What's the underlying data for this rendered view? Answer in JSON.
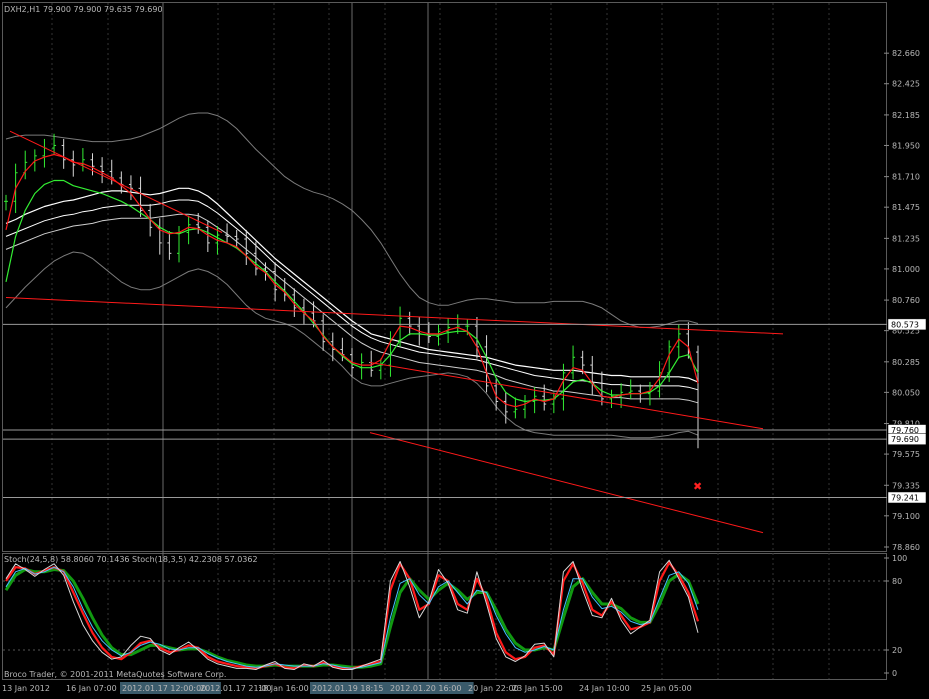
{
  "chart_data": {
    "type": "line",
    "header": {
      "symbol": "DXH2,H1",
      "ohlc": "79.900 79.900 79.635 79.690"
    },
    "price_axis": {
      "ylim": [
        78.86,
        82.9
      ],
      "ticks": [
        "82.660",
        "82.425",
        "82.185",
        "81.950",
        "81.710",
        "81.475",
        "81.235",
        "81.000",
        "80.760",
        "80.525",
        "80.285",
        "80.050",
        "79.810",
        "79.575",
        "79.335",
        "79.100",
        "78.860"
      ]
    },
    "levels": [
      {
        "label": "80.573",
        "value": 80.573
      },
      {
        "label": "79.760",
        "value": 79.76
      },
      {
        "label": "79.690",
        "value": 79.69
      },
      {
        "label": "79.241",
        "value": 79.241
      }
    ],
    "time_axis": {
      "labels": [
        "13 Jan 2012",
        "16 Jan 07:00",
        "2012.01.17 12:00:00",
        "2012.01.17 21:00",
        "18 Jan 16:00",
        "2012.01.19 18:15",
        "2012.01.20 16:00",
        "20 Jan 22:00",
        "23 Jan 15:00",
        "24 Jan 10:00",
        "25 Jan 05:00"
      ],
      "highlighted": [
        "2012.01.17 12:00:00",
        "2012.01.19 18:15",
        "2012.01.20 16:00"
      ]
    },
    "series": [
      {
        "name": "Close",
        "y": [
          81.52,
          81.74,
          81.82,
          81.87,
          81.93,
          81.95,
          81.84,
          81.8,
          81.84,
          81.79,
          81.75,
          81.7,
          81.65,
          81.62,
          81.45,
          81.32,
          81.2,
          81.12,
          81.28,
          81.34,
          81.32,
          81.2,
          81.26,
          81.25,
          81.23,
          81.12,
          81.0,
          80.98,
          80.84,
          80.8,
          80.7,
          80.66,
          80.6,
          80.44,
          80.38,
          80.34,
          80.24,
          80.28,
          80.22,
          80.26,
          80.45,
          80.62,
          80.56,
          80.5,
          80.48,
          80.52,
          80.55,
          80.56,
          80.56,
          80.4,
          80.1,
          79.98,
          79.9,
          79.92,
          79.98,
          80.02,
          79.96,
          80.0,
          80.2,
          80.32,
          80.26,
          80.12,
          80.0,
          80.02,
          80.05,
          80.06,
          80.04,
          80.06,
          80.2,
          80.4,
          80.5,
          80.36,
          79.69
        ]
      },
      {
        "name": "MA fast",
        "y": [
          81.3,
          81.62,
          81.75,
          81.83,
          81.86,
          81.88,
          81.86,
          81.82,
          81.81,
          81.78,
          81.74,
          81.7,
          81.64,
          81.58,
          81.48,
          81.38,
          81.3,
          81.27,
          81.28,
          81.32,
          81.31,
          81.26,
          81.22,
          81.2,
          81.17,
          81.1,
          81.02,
          80.97,
          80.88,
          80.82,
          80.73,
          80.66,
          80.6,
          80.48,
          80.4,
          80.34,
          80.28,
          80.26,
          80.26,
          80.3,
          80.44,
          80.56,
          80.55,
          80.52,
          80.5,
          80.5,
          80.53,
          80.55,
          80.52,
          80.4,
          80.2,
          80.02,
          79.96,
          79.94,
          79.96,
          80.0,
          79.98,
          80.0,
          80.14,
          80.24,
          80.22,
          80.12,
          80.02,
          80.01,
          80.03,
          80.04,
          80.04,
          80.06,
          80.16,
          80.34,
          80.46,
          80.4,
          80.12
        ]
      },
      {
        "name": "MA slow",
        "y": [
          80.9,
          81.25,
          81.45,
          81.58,
          81.65,
          81.68,
          81.68,
          81.64,
          81.62,
          81.6,
          81.58,
          81.55,
          81.52,
          81.48,
          81.43,
          81.38,
          81.32,
          81.28,
          81.27,
          81.3,
          81.31,
          81.28,
          81.24,
          81.2,
          81.16,
          81.1,
          81.04,
          80.98,
          80.9,
          80.83,
          80.75,
          80.67,
          80.58,
          80.49,
          80.4,
          80.33,
          80.27,
          80.24,
          80.24,
          80.26,
          80.34,
          80.45,
          80.5,
          80.5,
          80.49,
          80.49,
          80.51,
          80.52,
          80.52,
          80.46,
          80.32,
          80.16,
          80.05,
          80.0,
          79.98,
          79.99,
          79.99,
          80.0,
          80.06,
          80.13,
          80.15,
          80.12,
          80.06,
          80.03,
          80.03,
          80.04,
          80.04,
          80.05,
          80.1,
          80.2,
          80.32,
          80.34,
          80.2
        ]
      },
      {
        "name": "EMA 1",
        "y": [
          81.35,
          81.38,
          81.42,
          81.45,
          81.48,
          81.5,
          81.52,
          81.53,
          81.55,
          81.57,
          81.59,
          81.6,
          81.6,
          81.59,
          81.58,
          81.57,
          81.58,
          81.6,
          81.62,
          81.62,
          81.6,
          81.56,
          81.5,
          81.43,
          81.36,
          81.29,
          81.22,
          81.15,
          81.08,
          81.02,
          80.96,
          80.9,
          80.84,
          80.78,
          80.72,
          80.66,
          80.6,
          80.55,
          80.5,
          80.48,
          80.46,
          80.44,
          80.42,
          80.4,
          80.38,
          80.37,
          80.36,
          80.35,
          80.34,
          80.33,
          80.32,
          80.3,
          80.28,
          80.26,
          80.25,
          80.24,
          80.23,
          80.22,
          80.22,
          80.22,
          80.21,
          80.2,
          80.19,
          80.18,
          80.18,
          80.17,
          80.17,
          80.17,
          80.17,
          80.17,
          80.17,
          80.16,
          80.13
        ]
      },
      {
        "name": "EMA 2",
        "y": [
          81.25,
          81.28,
          81.31,
          81.34,
          81.37,
          81.39,
          81.41,
          81.42,
          81.44,
          81.45,
          81.47,
          81.48,
          81.49,
          81.49,
          81.49,
          81.49,
          81.5,
          81.52,
          81.53,
          81.53,
          81.52,
          81.48,
          81.43,
          81.37,
          81.31,
          81.25,
          81.18,
          81.11,
          81.04,
          80.98,
          80.92,
          80.86,
          80.8,
          80.74,
          80.68,
          80.62,
          80.56,
          80.51,
          80.47,
          80.44,
          80.42,
          80.4,
          80.38,
          80.36,
          80.35,
          80.34,
          80.33,
          80.32,
          80.31,
          80.3,
          80.28,
          80.26,
          80.24,
          80.22,
          80.2,
          80.18,
          80.17,
          80.16,
          80.15,
          80.14,
          80.14,
          80.13,
          80.12,
          80.11,
          80.11,
          80.1,
          80.1,
          80.1,
          80.1,
          80.1,
          80.1,
          80.09,
          80.07
        ]
      },
      {
        "name": "EMA 3",
        "y": [
          81.15,
          81.18,
          81.21,
          81.24,
          81.27,
          81.29,
          81.31,
          81.33,
          81.34,
          81.35,
          81.37,
          81.38,
          81.39,
          81.39,
          81.39,
          81.39,
          81.4,
          81.41,
          81.42,
          81.42,
          81.41,
          81.37,
          81.32,
          81.27,
          81.21,
          81.15,
          81.09,
          81.02,
          80.96,
          80.9,
          80.84,
          80.78,
          80.72,
          80.66,
          80.6,
          80.54,
          80.48,
          80.43,
          80.39,
          80.36,
          80.34,
          80.32,
          80.3,
          80.28,
          80.27,
          80.26,
          80.25,
          80.24,
          80.23,
          80.22,
          80.2,
          80.18,
          80.15,
          80.13,
          80.11,
          80.09,
          80.08,
          80.06,
          80.06,
          80.05,
          80.04,
          80.03,
          80.02,
          80.01,
          80.01,
          80.0,
          80.0,
          80.0,
          80.0,
          80.0,
          80.0,
          79.99,
          79.97
        ]
      },
      {
        "name": "Upper band",
        "y": [
          82.0,
          82.02,
          82.03,
          82.03,
          82.03,
          82.02,
          82.01,
          82.0,
          81.99,
          81.98,
          81.98,
          81.98,
          81.99,
          82.0,
          82.02,
          82.05,
          82.08,
          82.12,
          82.16,
          82.19,
          82.2,
          82.2,
          82.18,
          82.14,
          82.08,
          82.0,
          81.92,
          81.85,
          81.78,
          81.71,
          81.66,
          81.62,
          81.59,
          81.57,
          81.54,
          81.5,
          81.45,
          81.38,
          81.3,
          81.2,
          81.08,
          80.96,
          80.86,
          80.78,
          80.74,
          80.72,
          80.72,
          80.74,
          80.76,
          80.77,
          80.77,
          80.76,
          80.75,
          80.74,
          80.74,
          80.74,
          80.74,
          80.75,
          80.75,
          80.75,
          80.75,
          80.73,
          80.7,
          80.65,
          80.6,
          80.57,
          80.55,
          80.55,
          80.56,
          80.58,
          80.6,
          80.6,
          80.58
        ]
      },
      {
        "name": "Lower band",
        "y": [
          80.7,
          80.78,
          80.86,
          80.93,
          81.0,
          81.06,
          81.1,
          81.13,
          81.12,
          81.08,
          81.02,
          80.96,
          80.9,
          80.86,
          80.84,
          80.84,
          80.86,
          80.9,
          80.94,
          80.98,
          81.0,
          80.98,
          80.94,
          80.88,
          80.8,
          80.72,
          80.66,
          80.62,
          80.6,
          80.58,
          80.55,
          80.5,
          80.44,
          80.38,
          80.32,
          80.25,
          80.17,
          80.12,
          80.1,
          80.1,
          80.12,
          80.14,
          80.16,
          80.17,
          80.18,
          80.19,
          80.2,
          80.19,
          80.17,
          80.12,
          80.04,
          79.94,
          79.86,
          79.8,
          79.76,
          79.74,
          79.73,
          79.72,
          79.72,
          79.72,
          79.72,
          79.72,
          79.72,
          79.72,
          79.71,
          79.7,
          79.7,
          79.7,
          79.71,
          79.72,
          79.74,
          79.75,
          79.72
        ]
      },
      {
        "name": "Trendline A",
        "y": [
          82.06,
          81.28
        ]
      },
      {
        "name": "Trendline B",
        "y": [
          80.78,
          80.5
        ]
      },
      {
        "name": "Channel line 1",
        "y": [
          80.28,
          79.77
        ]
      },
      {
        "name": "Channel line 2",
        "y": [
          79.74,
          78.97
        ]
      }
    ],
    "oscillator": {
      "label": "Stoch(24,5,8) 58.8060 70.1436  Stoch(18,3,5) 42.2308 57.0362",
      "ylim": [
        0,
        100
      ],
      "ticks": [
        "100",
        "80",
        "20",
        "0"
      ],
      "series": [
        {
          "name": "Stoch(24,5,8) %K",
          "y": [
            80,
            92,
            91,
            86,
            89,
            92,
            88,
            70,
            52,
            35,
            22,
            14,
            12,
            18,
            26,
            28,
            22,
            18,
            20,
            24,
            22,
            14,
            10,
            8,
            6,
            5,
            4,
            6,
            8,
            5,
            4,
            7,
            6,
            9,
            6,
            4,
            4,
            6,
            8,
            10,
            72,
            95,
            82,
            55,
            60,
            85,
            80,
            60,
            55,
            82,
            65,
            35,
            18,
            12,
            14,
            22,
            24,
            16,
            80,
            95,
            78,
            55,
            50,
            62,
            50,
            38,
            40,
            44,
            80,
            96,
            85,
            70,
            45
          ]
        },
        {
          "name": "Stoch(24,5,8) %D",
          "y": [
            72,
            85,
            90,
            88,
            88,
            90,
            89,
            80,
            65,
            48,
            33,
            22,
            16,
            16,
            20,
            24,
            24,
            22,
            20,
            21,
            21,
            18,
            14,
            11,
            9,
            7,
            6,
            6,
            7,
            6,
            6,
            6,
            6,
            7,
            7,
            6,
            5,
            5,
            6,
            8,
            40,
            70,
            82,
            72,
            64,
            72,
            78,
            72,
            64,
            70,
            70,
            55,
            38,
            26,
            20,
            20,
            22,
            20,
            48,
            75,
            82,
            70,
            60,
            60,
            56,
            48,
            44,
            44,
            60,
            80,
            86,
            80,
            60
          ]
        },
        {
          "name": "Stoch(18,3,5) %K",
          "y": [
            82,
            95,
            90,
            84,
            90,
            95,
            85,
            62,
            42,
            28,
            18,
            12,
            14,
            24,
            32,
            30,
            20,
            16,
            22,
            27,
            20,
            12,
            8,
            6,
            4,
            4,
            3,
            7,
            10,
            4,
            3,
            8,
            6,
            11,
            5,
            3,
            3,
            6,
            9,
            12,
            80,
            97,
            75,
            48,
            62,
            90,
            78,
            55,
            52,
            88,
            60,
            30,
            14,
            10,
            15,
            25,
            26,
            14,
            88,
            97,
            72,
            50,
            48,
            65,
            46,
            34,
            40,
            46,
            88,
            98,
            82,
            66,
            35
          ]
        },
        {
          "name": "Stoch(18,3,5) %D",
          "y": [
            75,
            88,
            91,
            86,
            88,
            92,
            88,
            75,
            56,
            40,
            28,
            20,
            15,
            18,
            24,
            27,
            25,
            21,
            20,
            22,
            22,
            17,
            13,
            10,
            8,
            6,
            5,
            6,
            8,
            7,
            6,
            6,
            6,
            8,
            7,
            5,
            4,
            5,
            7,
            9,
            48,
            78,
            82,
            68,
            60,
            75,
            80,
            70,
            60,
            72,
            70,
            50,
            34,
            22,
            18,
            20,
            23,
            20,
            55,
            82,
            82,
            66,
            56,
            58,
            53,
            45,
            42,
            44,
            65,
            85,
            88,
            78,
            55
          ]
        }
      ]
    },
    "watermark": "Broco Trader, © 2001-2011 MetaQuotes Software Corp.",
    "colors": {
      "background": "#000000",
      "candles": "#d8d8d8",
      "close": "#ff1a1a",
      "ma_fast": "#ff1a1a",
      "ma_slow": "#33ee33",
      "emas": "#ffffff",
      "bands": "#7a7a7a",
      "trendlines": "#ff1a1a",
      "level_lines": "#9a9a9a",
      "osc_k": "#ff1a1a",
      "osc_d": "#119911",
      "osc_k2": "#d8d8d8",
      "osc_d2": "#44c4ff",
      "grid": "#333333",
      "highlight": "#3a5a6a"
    }
  }
}
